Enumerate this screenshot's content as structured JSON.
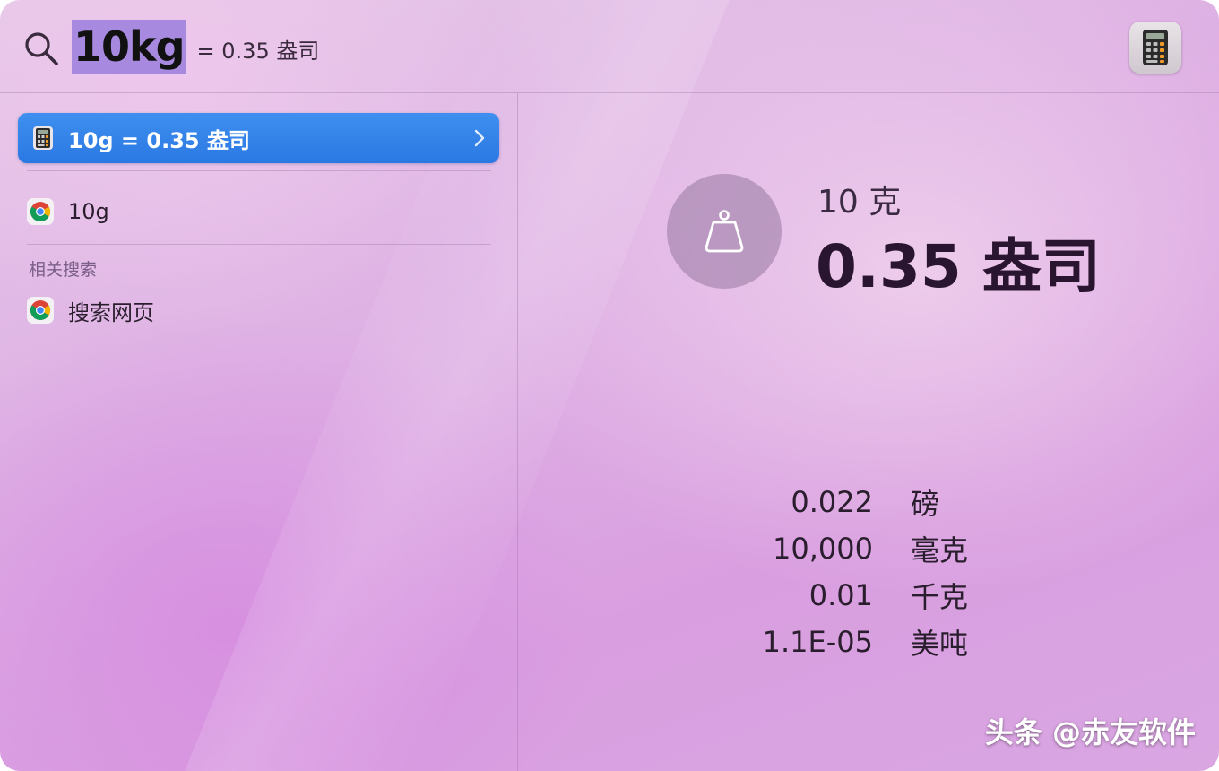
{
  "search": {
    "query": "10kg",
    "inline_result": "= 0.35 盎司"
  },
  "results": {
    "top_hit": {
      "label": "10g = 0.35 盎司",
      "icon": "calculator-icon"
    },
    "items": [
      {
        "label": "10g",
        "icon": "chrome-icon"
      }
    ],
    "related_header": "相关搜索",
    "related": [
      {
        "label": "搜索网页",
        "icon": "chrome-icon"
      }
    ]
  },
  "preview": {
    "from": "10 克",
    "to": "0.35 盎司",
    "icon": "weight-icon",
    "conversions": [
      {
        "value": "0.022",
        "unit": "磅"
      },
      {
        "value": "10,000",
        "unit": "毫克"
      },
      {
        "value": "0.01",
        "unit": "千克"
      },
      {
        "value": "1.1E-05",
        "unit": "美吨"
      }
    ]
  },
  "watermark": "头条 @赤友软件",
  "colors": {
    "selection_highlight": "#a889e0",
    "top_hit_blue": "#2a78e2"
  }
}
